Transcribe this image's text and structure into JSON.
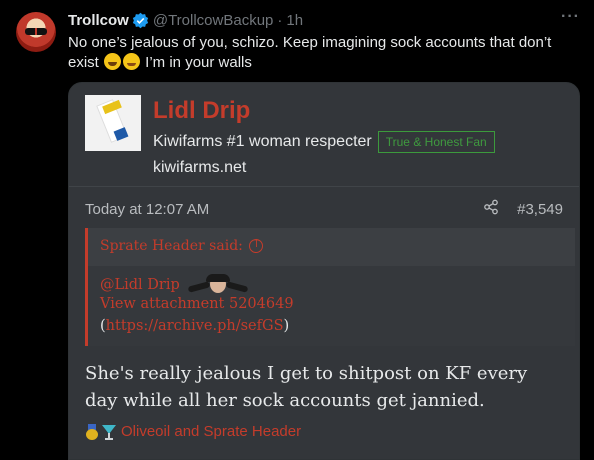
{
  "tweet": {
    "author_name": "Trollcow",
    "handle": "@TrollcowBackup",
    "separator": "·",
    "time": "1h",
    "more_label": "···",
    "text_part1": "No one’s jealous of you, schizo. Keep imagining sock accounts that don’t exist ",
    "text_part2": " I’m in your walls"
  },
  "card": {
    "site_title": "Lidl Drip",
    "site_subtitle": "Kiwifarms #1 woman respecter",
    "badge": "True & Honest Fan",
    "site_url": "kiwifarms.net",
    "post_time": "Today at 12:07 AM",
    "post_number": "#3,549",
    "quote": {
      "header": "Sprate Header said:",
      "mention": "@Lidl Drip",
      "attachment": "View attachment 5204649",
      "link_open": "(",
      "link": "https://archive.ph/sefGS",
      "link_close": ")"
    },
    "post_text": "She's really jealous I get to shitpost on KF every day while all her sock accounts get jannied.",
    "reactions_text": "Oliveoil and Sprate Header"
  },
  "colors": {
    "accent_red": "#c43c2b",
    "verified_blue": "#1d9bf0",
    "fan_green": "#3f9a3f"
  },
  "icons": [
    "verified-icon",
    "more-icon",
    "share-icon",
    "jump-up-icon",
    "medal-icon",
    "cocktail-icon"
  ]
}
